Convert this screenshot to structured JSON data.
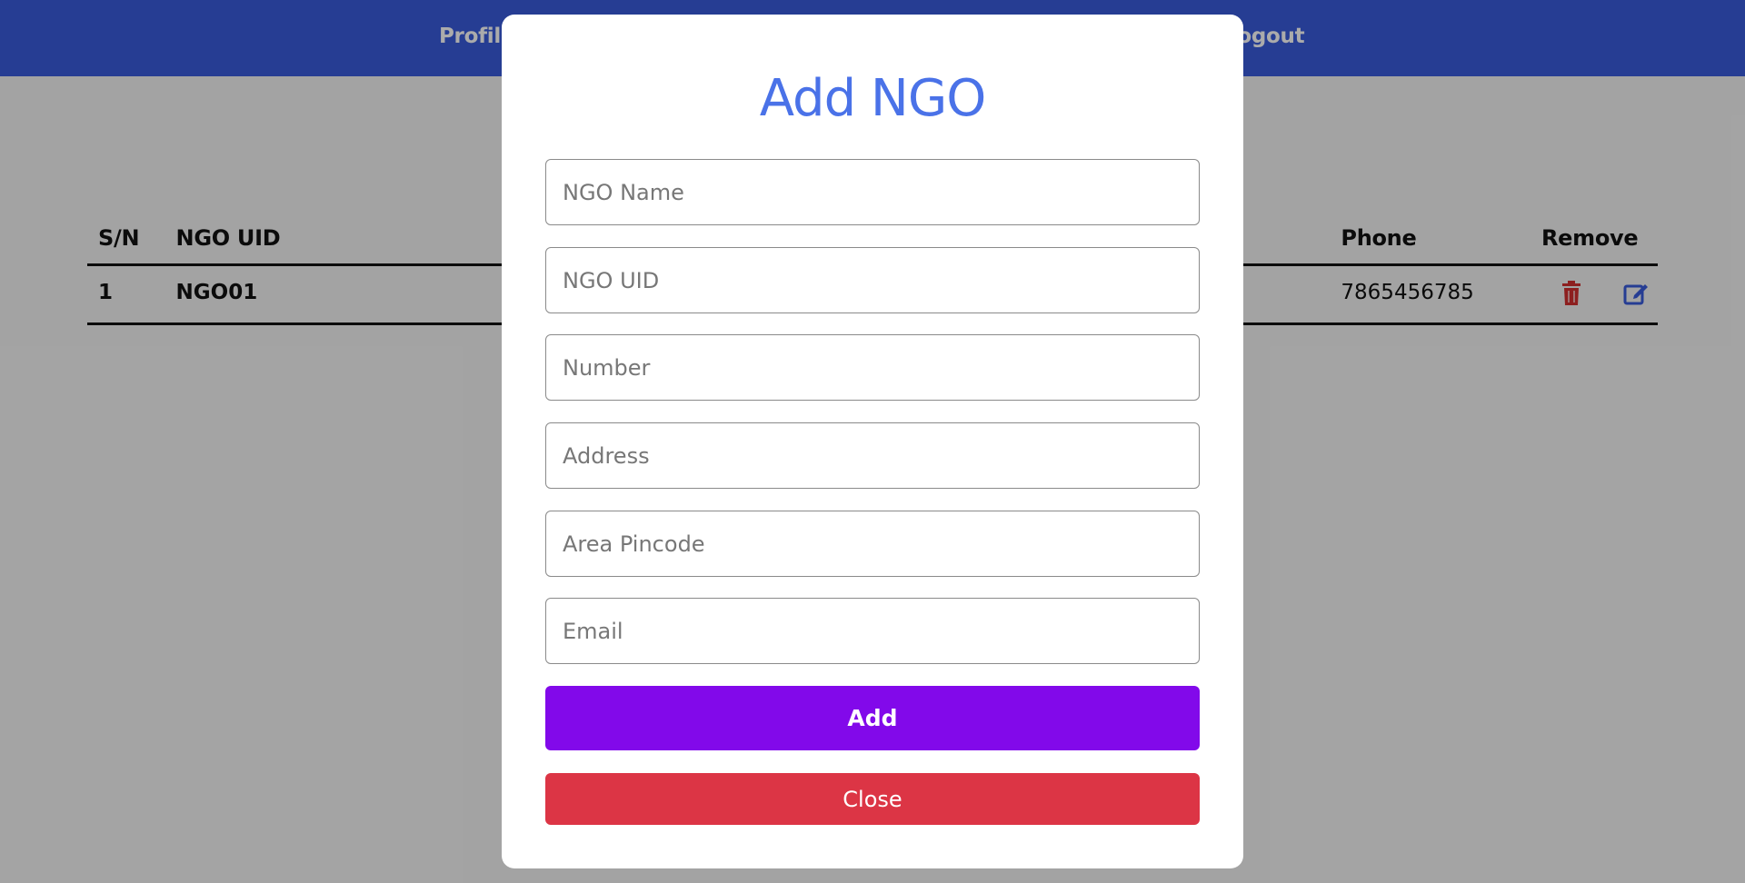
{
  "nav": {
    "profile_label": "Profile",
    "logout_label": "Logout"
  },
  "table": {
    "headers": [
      "S/N",
      "NGO UID",
      "Phone",
      "Remove"
    ],
    "rows": [
      {
        "sn": "1",
        "uid": "NGO01",
        "phone": "7865456785"
      }
    ],
    "delete_icon": "trash-icon",
    "edit_icon": "edit-icon"
  },
  "modal": {
    "title": "Add NGO",
    "fields": {
      "ngo_name": "NGO Name",
      "ngo_uid": "NGO UID",
      "number": "Number",
      "address": "Address",
      "area_pincode": "Area Pincode",
      "email": "Email"
    },
    "add_label": "Add",
    "close_label": "Close"
  },
  "colors": {
    "navbar": "#3a5bdc",
    "title": "#4a72e8",
    "add_button": "#8209ea",
    "close_button": "#dc3545",
    "delete_icon": "#d32f2f",
    "edit_icon": "#3a5bdc"
  }
}
